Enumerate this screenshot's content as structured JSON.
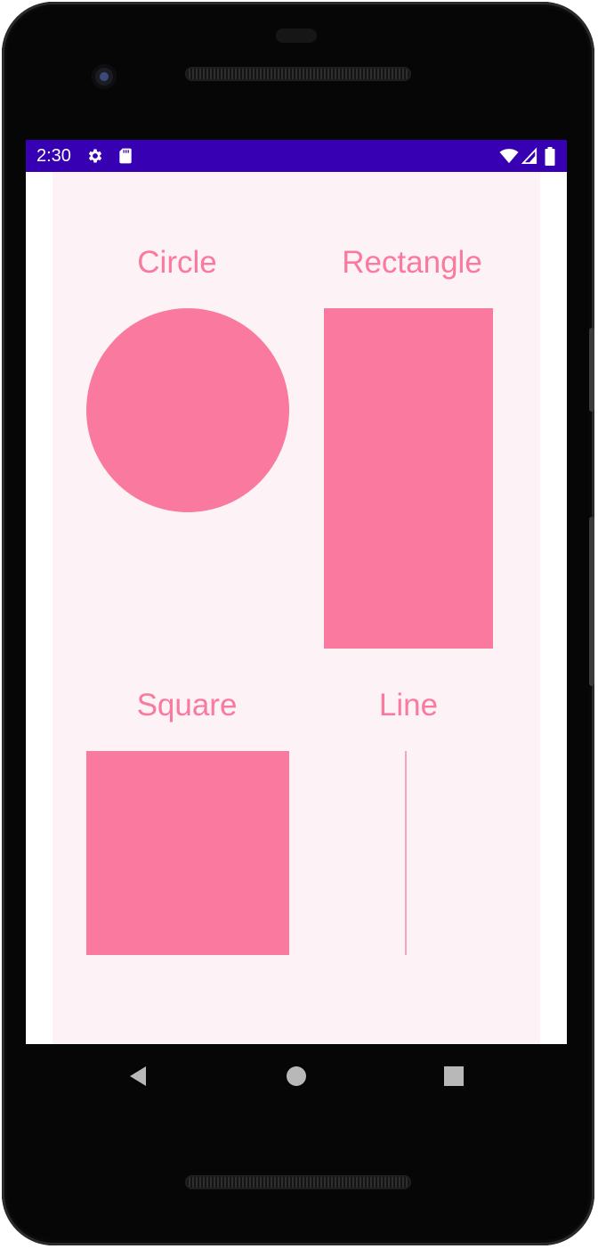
{
  "status_bar": {
    "time": "2:30",
    "background_color": "#3700b3",
    "left_icons": [
      "gear-icon",
      "sd-card-icon"
    ],
    "right_icons": [
      "wifi-icon",
      "signal-icon",
      "battery-icon"
    ]
  },
  "screen": {
    "background_color": "#fdf2f6",
    "shape_color": "#f97a9e",
    "labels": {
      "circle": "Circle",
      "rectangle": "Rectangle",
      "square": "Square",
      "line": "Line"
    }
  },
  "nav_bar": {
    "buttons": [
      "back-icon",
      "home-icon",
      "recents-icon"
    ]
  }
}
